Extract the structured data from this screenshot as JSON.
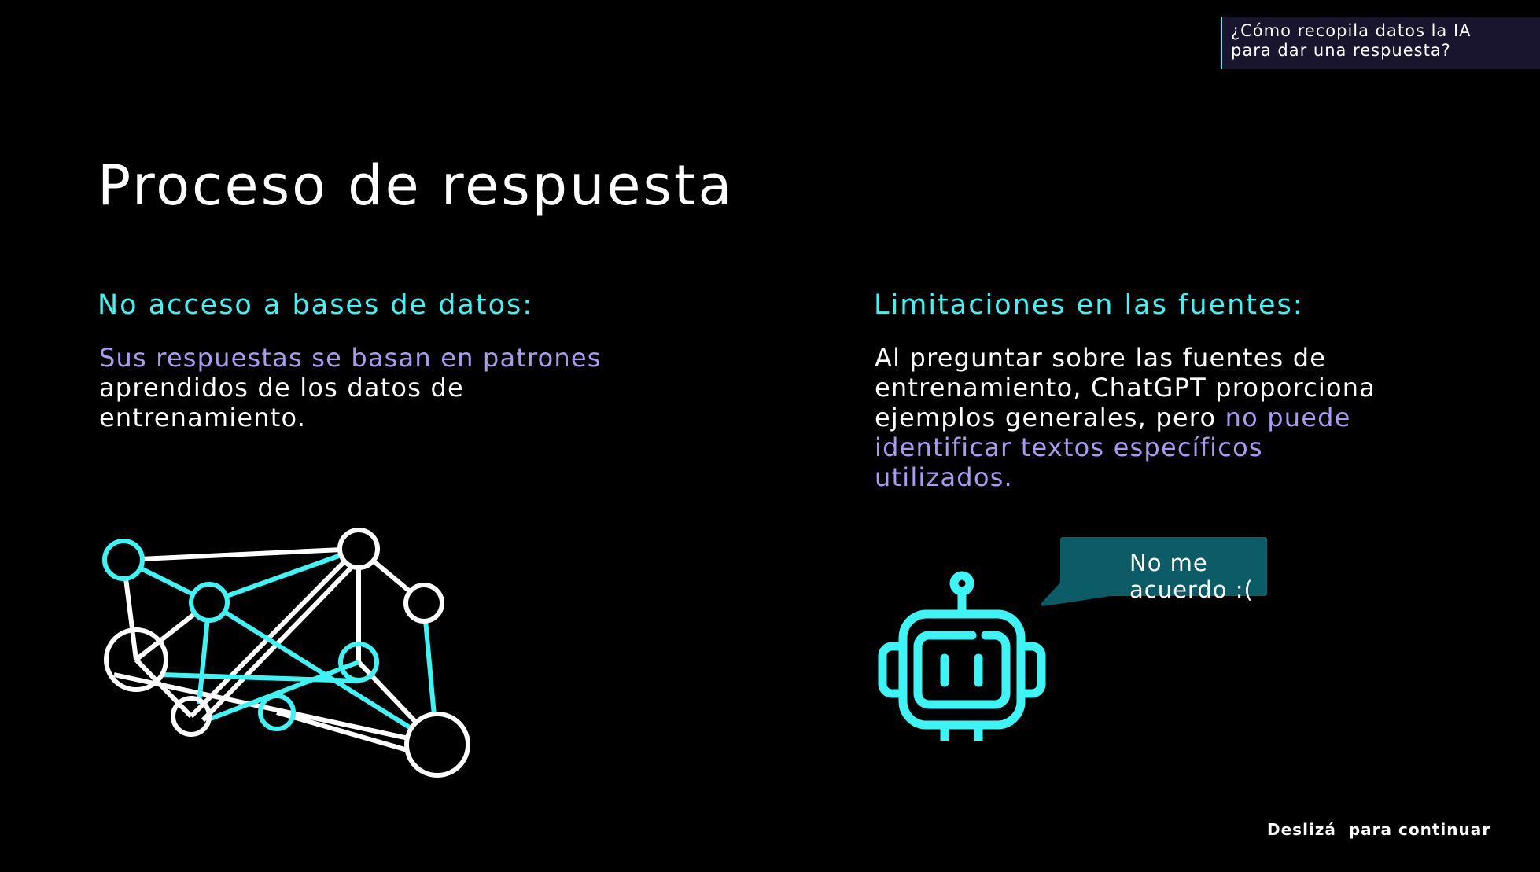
{
  "topic_box": {
    "line1": "¿Cómo recopila datos la IA",
    "line2": "para dar una respuesta?"
  },
  "title": "Proceso de respuesta",
  "left": {
    "heading": "No acceso a bases de datos:",
    "highlight": "Sus respuestas se basan en patrones",
    "line2": "aprendidos de los datos de",
    "line3": "entrenamiento."
  },
  "right": {
    "heading": "Limitaciones en las fuentes:",
    "line1": "Al preguntar sobre las fuentes de",
    "line2": "entrenamiento, ChatGPT proporciona",
    "line3_plain": "ejemplos generales, pero ",
    "line3_hl": "no puede",
    "line4": "identificar textos específicos",
    "line5": "utilizados."
  },
  "bubble": {
    "text": "No me acuerdo :("
  },
  "footer": "Deslizá  para continuar",
  "colors": {
    "accent": "#3ef5f5",
    "highlight": "#a99cf0",
    "bubble": "#0b5c66",
    "topic_bg": "#19152e"
  },
  "icons": [
    "network-graph-icon",
    "robot-icon",
    "speech-bubble-icon"
  ]
}
